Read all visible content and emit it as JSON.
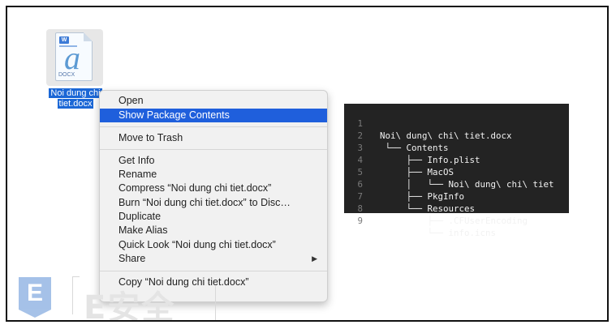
{
  "file": {
    "badge": "W",
    "glyph": "a",
    "extension": "DOCX",
    "label_line1": "Noi dung chi",
    "label_line2": "tiet.docx"
  },
  "context_menu": {
    "items": [
      {
        "label": "Open"
      },
      {
        "label": "Show Package Contents",
        "selected": true
      },
      {
        "label": "Move to Trash"
      },
      {
        "label": "Get Info"
      },
      {
        "label": "Rename"
      },
      {
        "label": "Compress “Noi dung chi tiet.docx”"
      },
      {
        "label": "Burn “Noi dung chi tiet.docx” to Disc…"
      },
      {
        "label": "Duplicate"
      },
      {
        "label": "Make Alias"
      },
      {
        "label": "Quick Look “Noi dung chi tiet.docx”"
      },
      {
        "label": "Share",
        "submenu": true
      },
      {
        "label": "Copy “Noi dung chi tiet.docx”"
      }
    ],
    "submenu_arrow": "▶"
  },
  "terminal": {
    "lines": [
      {
        "n": "1",
        "text": "Noi\\ dung\\ chi\\ tiet.docx"
      },
      {
        "n": "2",
        "text": " └── Contents"
      },
      {
        "n": "3",
        "text": "     ├── Info.plist"
      },
      {
        "n": "4",
        "text": "     ├── MacOS"
      },
      {
        "n": "5",
        "text": "     │   └── Noi\\ dung\\ chi\\ tiet"
      },
      {
        "n": "6",
        "text": "     ├── PkgInfo"
      },
      {
        "n": "7",
        "text": "     └── Resources"
      },
      {
        "n": "8",
        "text": "         ├── .CFUserEncoding"
      },
      {
        "n": "9",
        "text": "         └── info.icns"
      }
    ]
  },
  "watermark": {
    "logo_letter": "E",
    "text": "E安全"
  }
}
